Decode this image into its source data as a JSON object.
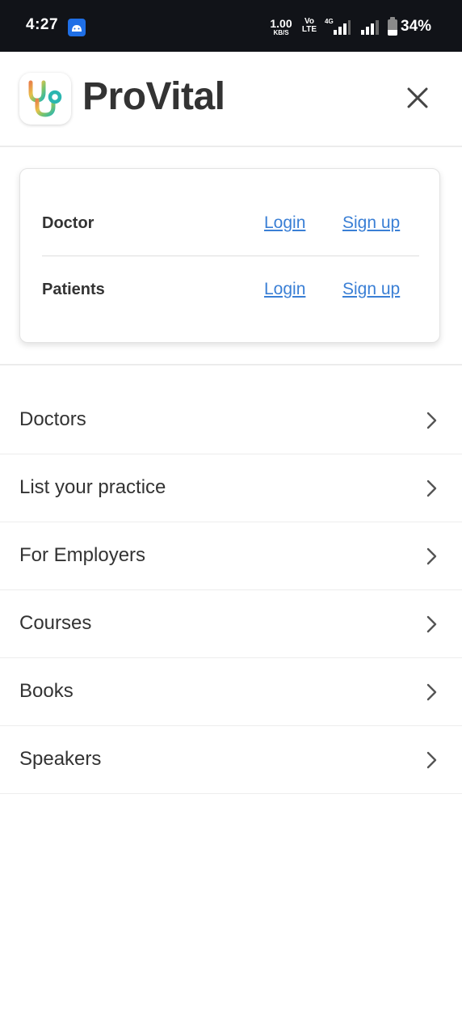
{
  "status_bar": {
    "time": "4:27",
    "speed_value": "1.00",
    "speed_unit": "KB/S",
    "volte_top": "Vo",
    "volte_bottom": "LTE",
    "network_type": "4G",
    "battery_percent": "34%",
    "battery_level": 0.34,
    "notification_icon": "app-notification-icon"
  },
  "header": {
    "brand_name": "ProVital",
    "logo_icon": "stethoscope-logo-icon",
    "close_icon": "close-icon",
    "logo_colors": [
      "#e8834a",
      "#e8c14a",
      "#7cc46a",
      "#2bb6b0"
    ]
  },
  "auth": {
    "rows": [
      {
        "role": "Doctor",
        "login": "Login",
        "signup": "Sign up"
      },
      {
        "role": "Patients",
        "login": "Login",
        "signup": "Sign up"
      }
    ],
    "link_color": "#3a7fd5"
  },
  "menu": {
    "items": [
      {
        "label": "Doctors"
      },
      {
        "label": "List your practice"
      },
      {
        "label": "For Employers"
      },
      {
        "label": "Courses"
      },
      {
        "label": "Books"
      },
      {
        "label": "Speakers"
      }
    ],
    "chevron_icon": "chevron-right-icon"
  }
}
